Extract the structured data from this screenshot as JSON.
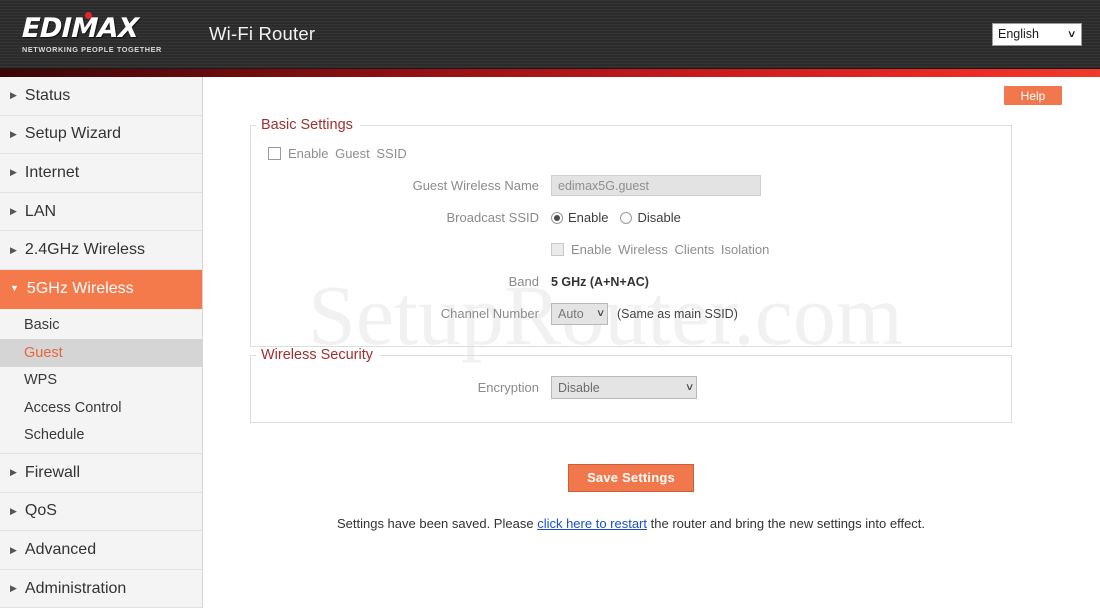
{
  "header": {
    "logo_text": "EDIMAX",
    "logo_tagline": "NETWORKING PEOPLE TOGETHER",
    "title": "Wi-Fi Router",
    "language_selected": "English",
    "chevron_icon": "∨"
  },
  "help": {
    "label": "Help"
  },
  "watermark": {
    "text": "SetupRouter.com"
  },
  "sidebar": {
    "items": [
      {
        "label": "Status",
        "marker": "▶",
        "type": "top"
      },
      {
        "label": "Setup Wizard",
        "marker": "▶",
        "type": "top"
      },
      {
        "label": "Internet",
        "marker": "▶",
        "type": "top"
      },
      {
        "label": "LAN",
        "marker": "▶",
        "type": "top"
      },
      {
        "label": "2.4GHz Wireless",
        "marker": "▶",
        "type": "top"
      },
      {
        "label": "5GHz Wireless",
        "marker": "▼",
        "type": "top-active"
      }
    ],
    "sub_items": [
      {
        "label": "Basic",
        "selected": false
      },
      {
        "label": "Guest",
        "selected": true
      },
      {
        "label": "WPS",
        "selected": false
      },
      {
        "label": "Access Control",
        "selected": false
      },
      {
        "label": "Schedule",
        "selected": false
      }
    ],
    "items_after": [
      {
        "label": "Firewall",
        "marker": "▶",
        "type": "top"
      },
      {
        "label": "QoS",
        "marker": "▶",
        "type": "top"
      },
      {
        "label": "Advanced",
        "marker": "▶",
        "type": "top"
      },
      {
        "label": "Administration",
        "marker": "▶",
        "type": "top"
      }
    ]
  },
  "basic_settings": {
    "legend": "Basic Settings",
    "enable_guest_ssid_label": "Enable  Guest  SSID",
    "enable_guest_ssid_checked": false,
    "guest_wireless_name_label": "Guest Wireless Name",
    "guest_wireless_name_value": "edimax5G.guest",
    "broadcast_ssid_label": "Broadcast SSID",
    "broadcast_ssid_enable": "Enable",
    "broadcast_ssid_disable": "Disable",
    "broadcast_ssid_selected": "Enable",
    "clients_isolation_label": "Enable Wireless Clients Isolation",
    "clients_isolation_checked": false,
    "band_label": "Band",
    "band_value": "5 GHz (A+N+AC)",
    "channel_number_label": "Channel Number",
    "channel_number_value": "Auto",
    "channel_note": "(Same as main SSID)"
  },
  "wireless_security": {
    "legend": "Wireless  Security",
    "encryption_label": "Encryption",
    "encryption_value": "Disable"
  },
  "footer": {
    "save_label": "Save Settings",
    "status_prefix": "Settings have been saved. Please",
    "status_link": "click here to restart",
    "status_suffix": "the router and bring the new settings into effect."
  },
  "colors": {
    "accent_orange": "#f4794b",
    "header_dark": "#2e2e2e",
    "legend_red": "#a03030",
    "link_blue": "#1a4fd0"
  }
}
